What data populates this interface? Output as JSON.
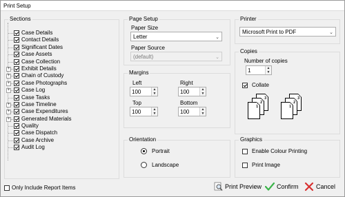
{
  "window": {
    "title": "Print Setup"
  },
  "sections": {
    "title": "Sections",
    "items": [
      {
        "label": "Case Details",
        "checked": true,
        "expandable": false
      },
      {
        "label": "Contact Details",
        "checked": true,
        "expandable": false
      },
      {
        "label": "Significant Dates",
        "checked": true,
        "expandable": false
      },
      {
        "label": "Case Assets",
        "checked": true,
        "expandable": false
      },
      {
        "label": "Case Collection",
        "checked": true,
        "expandable": false
      },
      {
        "label": "Exhibit Details",
        "checked": true,
        "expandable": true
      },
      {
        "label": "Chain of Custody",
        "checked": true,
        "expandable": true
      },
      {
        "label": "Case Photographs",
        "checked": true,
        "expandable": true
      },
      {
        "label": "Case Log",
        "checked": true,
        "expandable": true
      },
      {
        "label": "Case Tasks",
        "checked": true,
        "expandable": false
      },
      {
        "label": "Case Timeline",
        "checked": true,
        "expandable": true
      },
      {
        "label": "Case Expenditures",
        "checked": true,
        "expandable": true
      },
      {
        "label": "Generated Materials",
        "checked": true,
        "expandable": true
      },
      {
        "label": "Quality",
        "checked": true,
        "expandable": false
      },
      {
        "label": "Case Dispatch",
        "checked": true,
        "expandable": false
      },
      {
        "label": "Case Archive",
        "checked": true,
        "expandable": false
      },
      {
        "label": "Audit Log",
        "checked": true,
        "expandable": false
      }
    ],
    "only_include_report_items": "Only Include Report Items"
  },
  "page_setup": {
    "title": "Page Setup",
    "paper_size_label": "Paper Size",
    "paper_size_value": "Letter",
    "paper_source_label": "Paper Source",
    "paper_source_value": "(default)"
  },
  "margins": {
    "title": "Margins",
    "left_label": "Left",
    "left_value": "100",
    "right_label": "Right",
    "right_value": "100",
    "top_label": "Top",
    "top_value": "100",
    "bottom_label": "Bottom",
    "bottom_value": "100"
  },
  "orientation": {
    "title": "Orientation",
    "portrait": "Portrait",
    "landscape": "Landscape",
    "selected": "portrait"
  },
  "printer": {
    "title": "Printer",
    "value": "Microsoft Print to PDF"
  },
  "copies": {
    "title": "Copies",
    "number_label": "Number of copies",
    "number_value": "1",
    "collate_label": "Collate",
    "collate_checked": true,
    "page_numbers": [
      "1",
      "2",
      "3",
      "1",
      "2",
      "3"
    ]
  },
  "graphics": {
    "title": "Graphics",
    "enable_colour": "Enable Colour Printing",
    "print_image": "Print Image"
  },
  "buttons": {
    "print_preview": "Print Preview",
    "confirm": "Confirm",
    "cancel": "Cancel"
  },
  "colors": {
    "confirm_icon": "#3bb44a",
    "cancel_icon": "#d83030"
  },
  "icons": {
    "print_preview": "magnifier-page-icon",
    "confirm": "checkmark-icon",
    "cancel": "x-icon"
  }
}
